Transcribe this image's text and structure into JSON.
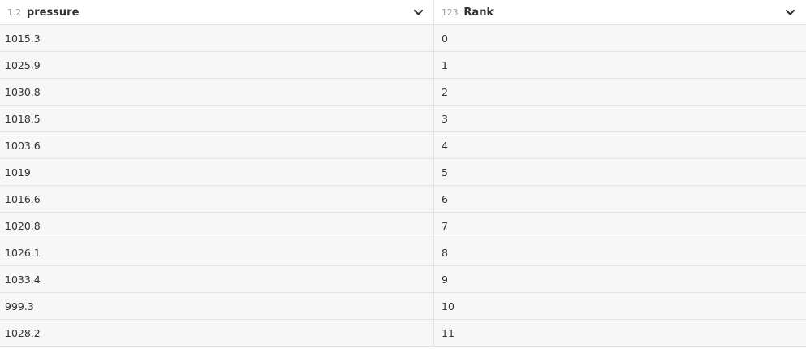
{
  "columns": [
    {
      "type_badge": "1.2",
      "name": "pressure",
      "menu_icon": "chevron-down-icon"
    },
    {
      "type_badge": "123",
      "name": "Rank",
      "menu_icon": "chevron-down-icon"
    }
  ],
  "rows": [
    {
      "pressure": "1015.3",
      "rank": "0"
    },
    {
      "pressure": "1025.9",
      "rank": "1"
    },
    {
      "pressure": "1030.8",
      "rank": "2"
    },
    {
      "pressure": "1018.5",
      "rank": "3"
    },
    {
      "pressure": "1003.6",
      "rank": "4"
    },
    {
      "pressure": "1019",
      "rank": "5"
    },
    {
      "pressure": "1016.6",
      "rank": "6"
    },
    {
      "pressure": "1020.8",
      "rank": "7"
    },
    {
      "pressure": "1026.1",
      "rank": "8"
    },
    {
      "pressure": "1033.4",
      "rank": "9"
    },
    {
      "pressure": "999.3",
      "rank": "10"
    },
    {
      "pressure": "1028.2",
      "rank": "11"
    }
  ],
  "colors": {
    "row_background": "#f7f7f7",
    "border": "#e2e2e2",
    "text": "#333333",
    "badge": "#9a9a9a"
  }
}
